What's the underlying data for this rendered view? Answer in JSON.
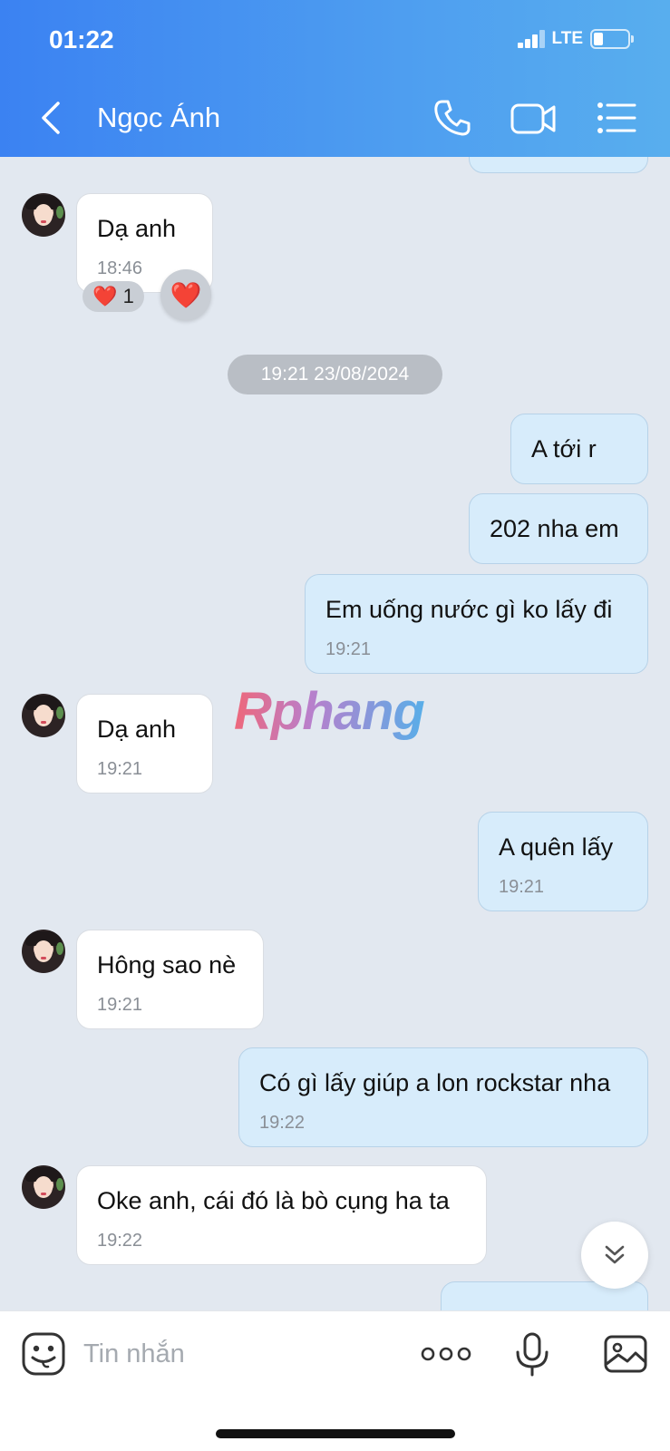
{
  "status_bar": {
    "time": "01:22",
    "network": "LTE",
    "battery_level": 0.2
  },
  "header": {
    "contact_name": "Ngọc Ánh"
  },
  "messages": [
    {
      "dir": "in",
      "text": "Dạ anh",
      "time": "18:46",
      "reaction": {
        "emoji": "❤️",
        "count": "1"
      }
    },
    {
      "dir": "out",
      "text": "A tới r"
    },
    {
      "dir": "out",
      "text": "202 nha em"
    },
    {
      "dir": "out",
      "text": "Em uống nước gì ko lấy đi",
      "time": "19:21"
    },
    {
      "dir": "in",
      "text": "Dạ anh",
      "time": "19:21"
    },
    {
      "dir": "out",
      "text": "A quên lấy",
      "time": "19:21"
    },
    {
      "dir": "in",
      "text": "Hông sao nè",
      "time": "19:21"
    },
    {
      "dir": "out",
      "text": "Có gì lấy giúp a lon rockstar nha",
      "time": "19:22"
    },
    {
      "dir": "in",
      "text": "Oke anh, cái đó là bò cụng ha ta",
      "time": "19:22"
    }
  ],
  "date_separator": "19:21 23/08/2024",
  "reaction_button": "❤️",
  "watermark": "Rphang",
  "composer": {
    "placeholder": "Tin nhắn"
  },
  "colors": {
    "header_start": "#3b82f2",
    "header_end": "#58aeee",
    "outgoing_bubble": "#d7ecfb",
    "incoming_bubble": "#ffffff"
  }
}
